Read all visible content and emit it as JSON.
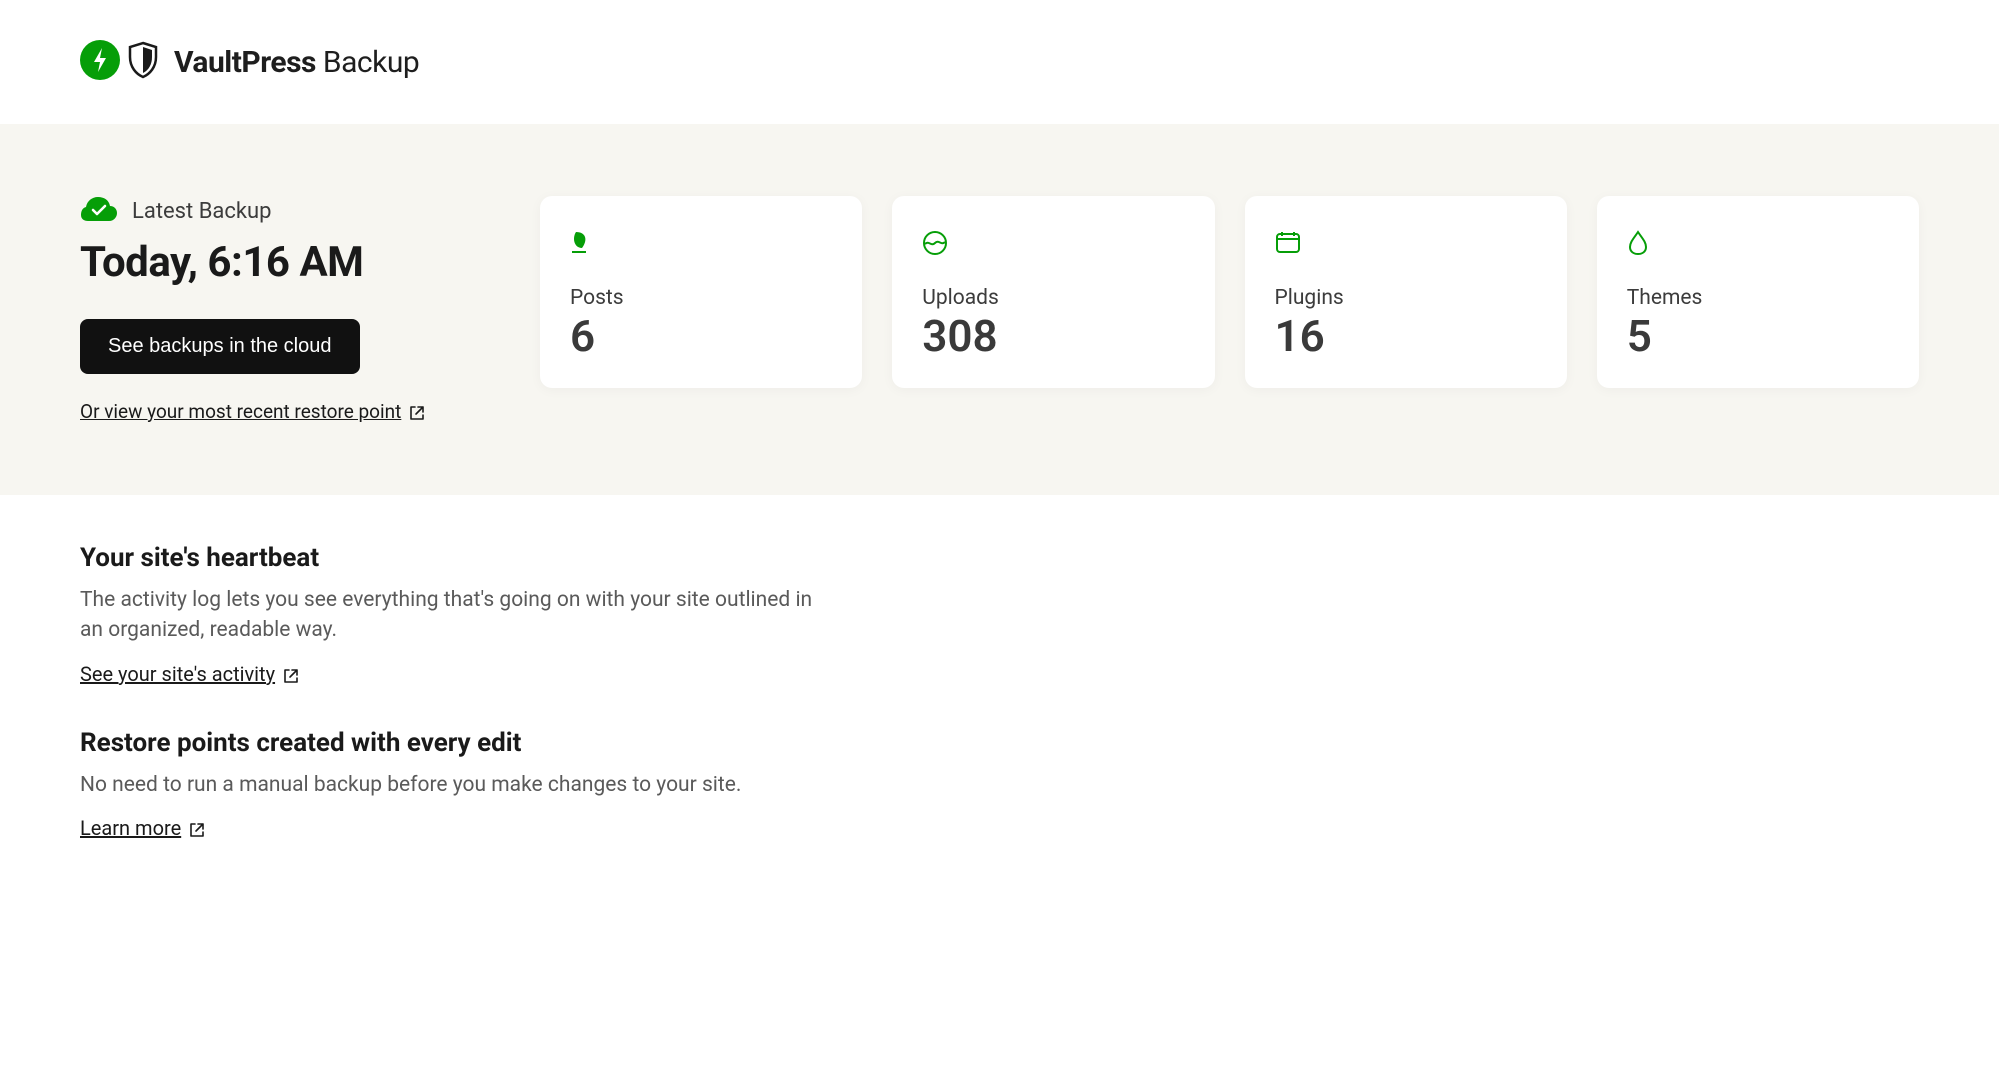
{
  "header": {
    "brand_bold": "VaultPress",
    "brand_light": "Backup"
  },
  "backup": {
    "latest_label": "Latest Backup",
    "time": "Today, 6:16 AM",
    "cta": "See backups in the cloud",
    "restore_link": "Or view your most recent restore point"
  },
  "stats": [
    {
      "icon": "leaf",
      "label": "Posts",
      "value": "6"
    },
    {
      "icon": "circle-wave",
      "label": "Uploads",
      "value": "308"
    },
    {
      "icon": "calendar",
      "label": "Plugins",
      "value": "16"
    },
    {
      "icon": "drop",
      "label": "Themes",
      "value": "5"
    }
  ],
  "sections": [
    {
      "title": "Your site's heartbeat",
      "desc": "The activity log lets you see everything that's going on with your site outlined in an organized, readable way.",
      "link": "See your site's activity"
    },
    {
      "title": "Restore points created with every edit",
      "desc": "No need to run a manual backup before you make changes to your site.",
      "link": "Learn more"
    }
  ]
}
